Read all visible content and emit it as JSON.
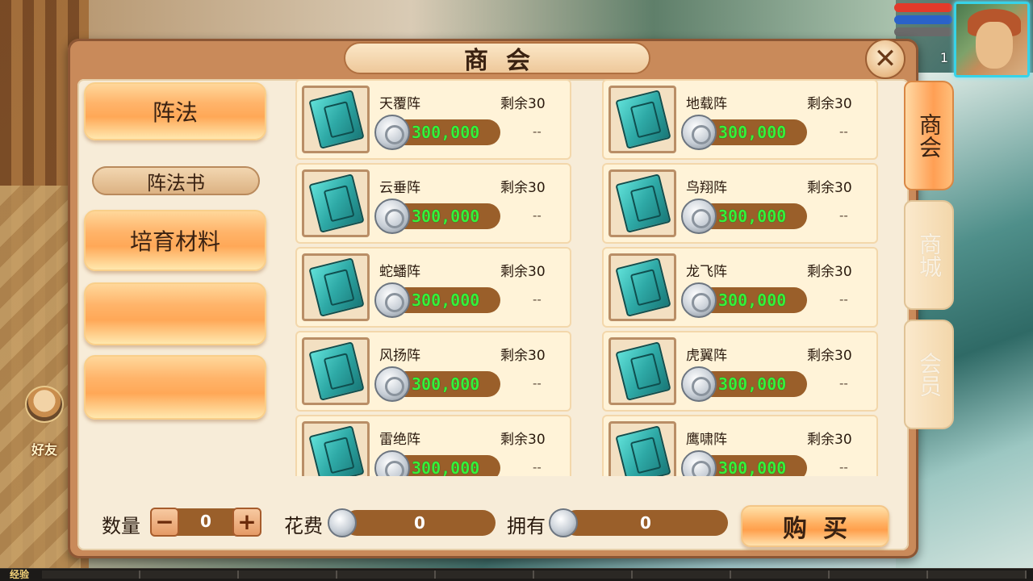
{
  "hud": {
    "level": "1",
    "colors": {
      "hp": "#e23a2a",
      "mp": "#2a62c9"
    }
  },
  "friend": {
    "label": "好友"
  },
  "exp_bar": {
    "label": "经验"
  },
  "dialog": {
    "title": "商会",
    "close_icon": "close-icon"
  },
  "categories": {
    "main": "阵法",
    "sub": "阵法书",
    "second": "培育材料",
    "empty1": "",
    "empty2": ""
  },
  "side_tabs": [
    {
      "label": "商会",
      "active": true
    },
    {
      "label": "商城",
      "active": false
    },
    {
      "label": "会员",
      "active": false
    }
  ],
  "items": [
    {
      "name": "天覆阵",
      "remaining": "剩余30",
      "price": "300,000",
      "owned": "--"
    },
    {
      "name": "地载阵",
      "remaining": "剩余30",
      "price": "300,000",
      "owned": "--"
    },
    {
      "name": "云垂阵",
      "remaining": "剩余30",
      "price": "300,000",
      "owned": "--"
    },
    {
      "name": "鸟翔阵",
      "remaining": "剩余30",
      "price": "300,000",
      "owned": "--"
    },
    {
      "name": "蛇蟠阵",
      "remaining": "剩余30",
      "price": "300,000",
      "owned": "--"
    },
    {
      "name": "龙飞阵",
      "remaining": "剩余30",
      "price": "300,000",
      "owned": "--"
    },
    {
      "name": "风扬阵",
      "remaining": "剩余30",
      "price": "300,000",
      "owned": "--"
    },
    {
      "name": "虎翼阵",
      "remaining": "剩余30",
      "price": "300,000",
      "owned": "--"
    },
    {
      "name": "雷绝阵",
      "remaining": "剩余30",
      "price": "300,000",
      "owned": "--"
    },
    {
      "name": "鹰啸阵",
      "remaining": "剩余30",
      "price": "300,000",
      "owned": "--"
    }
  ],
  "bottom": {
    "quantity_label": "数量",
    "minus": "−",
    "quantity_value": "0",
    "plus": "+",
    "cost_label": "花费",
    "cost_value": "0",
    "owned_label": "拥有",
    "owned_value": "0",
    "buy_label": "购买"
  }
}
